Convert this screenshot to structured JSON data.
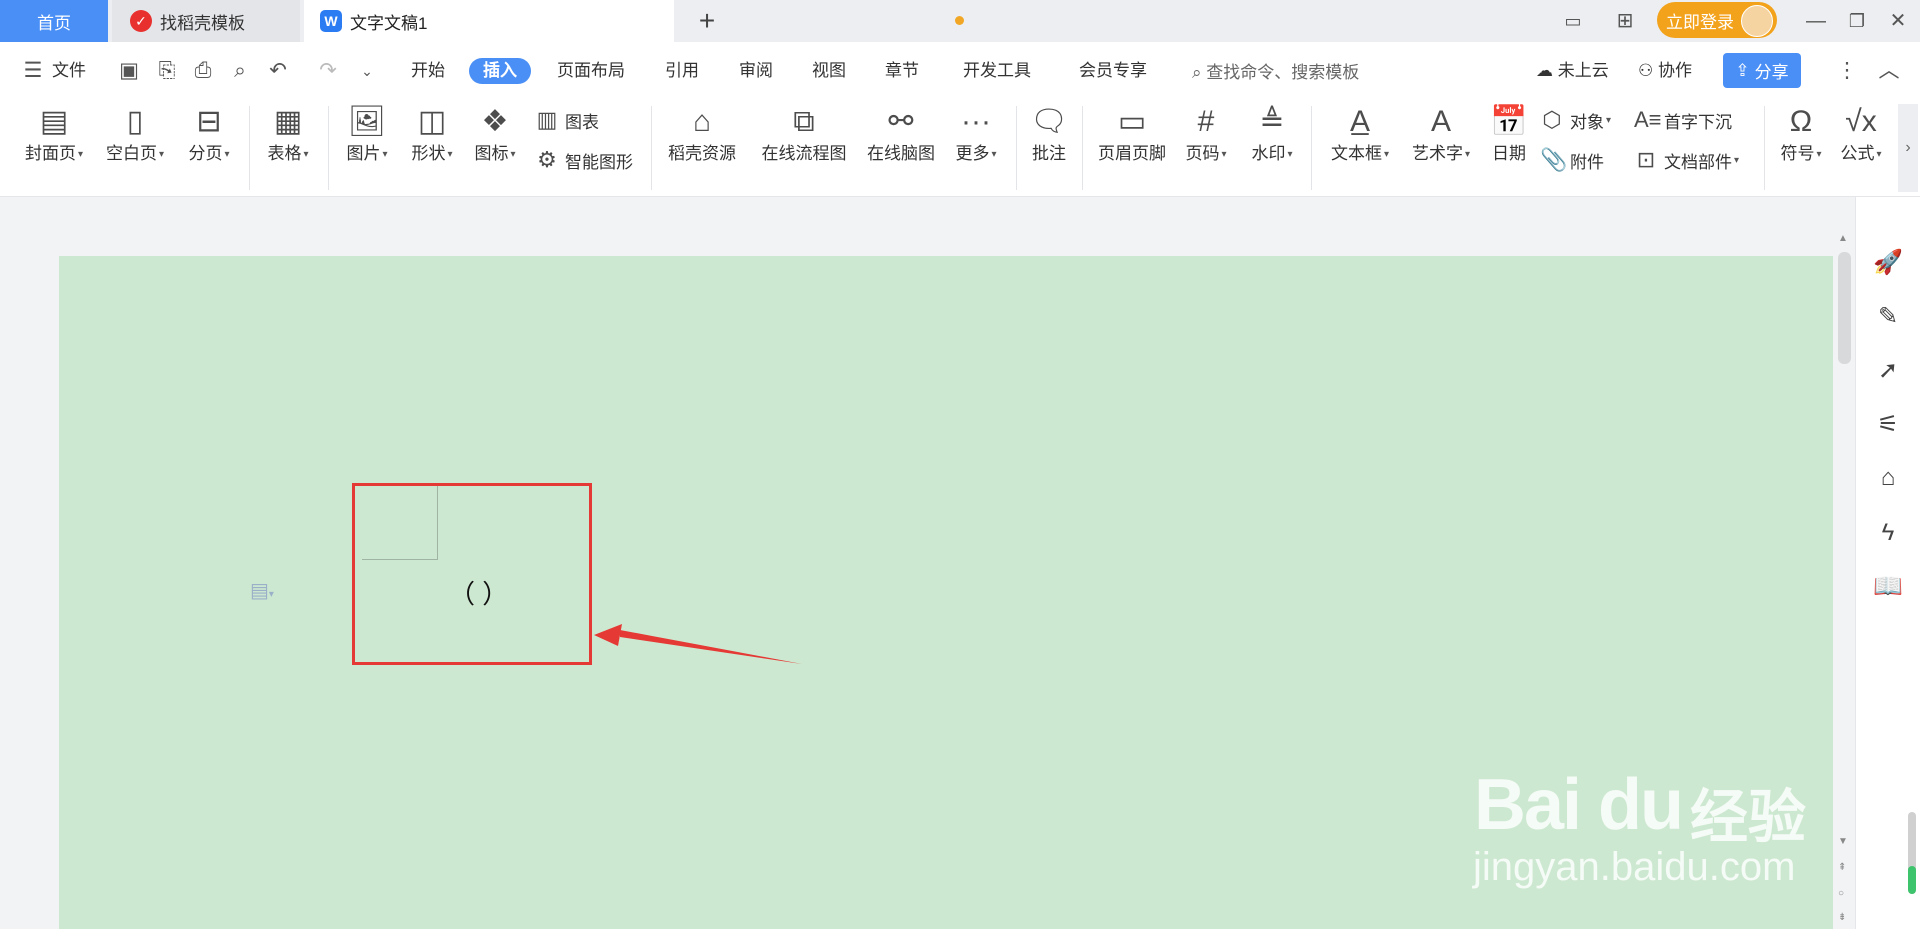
{
  "tabs": {
    "home": "首页",
    "template": "找稻壳模板",
    "document": "文字文稿1",
    "add": "+"
  },
  "topbar": {
    "login": "立即登录"
  },
  "menu": {
    "file": "文件",
    "items": [
      "开始",
      "插入",
      "页面布局",
      "引用",
      "审阅",
      "视图",
      "章节",
      "开发工具",
      "会员专享"
    ],
    "search_placeholder": "查找命令、搜索模板",
    "cloud": "未上云",
    "collab": "协作",
    "share": "分享"
  },
  "ribbon": {
    "cover": "封面页",
    "blank": "空白页",
    "pagebreak": "分页",
    "table": "表格",
    "picture": "图片",
    "shape": "形状",
    "icon": "图标",
    "chart": "图表",
    "smartart": "智能图形",
    "docer": "稻壳资源",
    "flowchart": "在线流程图",
    "mindmap": "在线脑图",
    "more": "更多",
    "comment": "批注",
    "headerfooter": "页眉页脚",
    "pagenum": "页码",
    "watermark": "水印",
    "textbox": "文本框",
    "wordart": "艺术字",
    "date": "日期",
    "object": "对象",
    "attachment": "附件",
    "dropcap": "首字下沉",
    "docpart": "文档部件",
    "symbol": "符号",
    "formula": "公式"
  },
  "document": {
    "content": "（   ）"
  },
  "watermark": {
    "brand": "Bai du",
    "brand_cn": "经验",
    "url": "jingyan.baidu.com"
  },
  "colors": {
    "accent": "#4a8ff6",
    "page_bg": "#cde8d0",
    "highlight": "#e53935",
    "login": "#f3a21c"
  }
}
